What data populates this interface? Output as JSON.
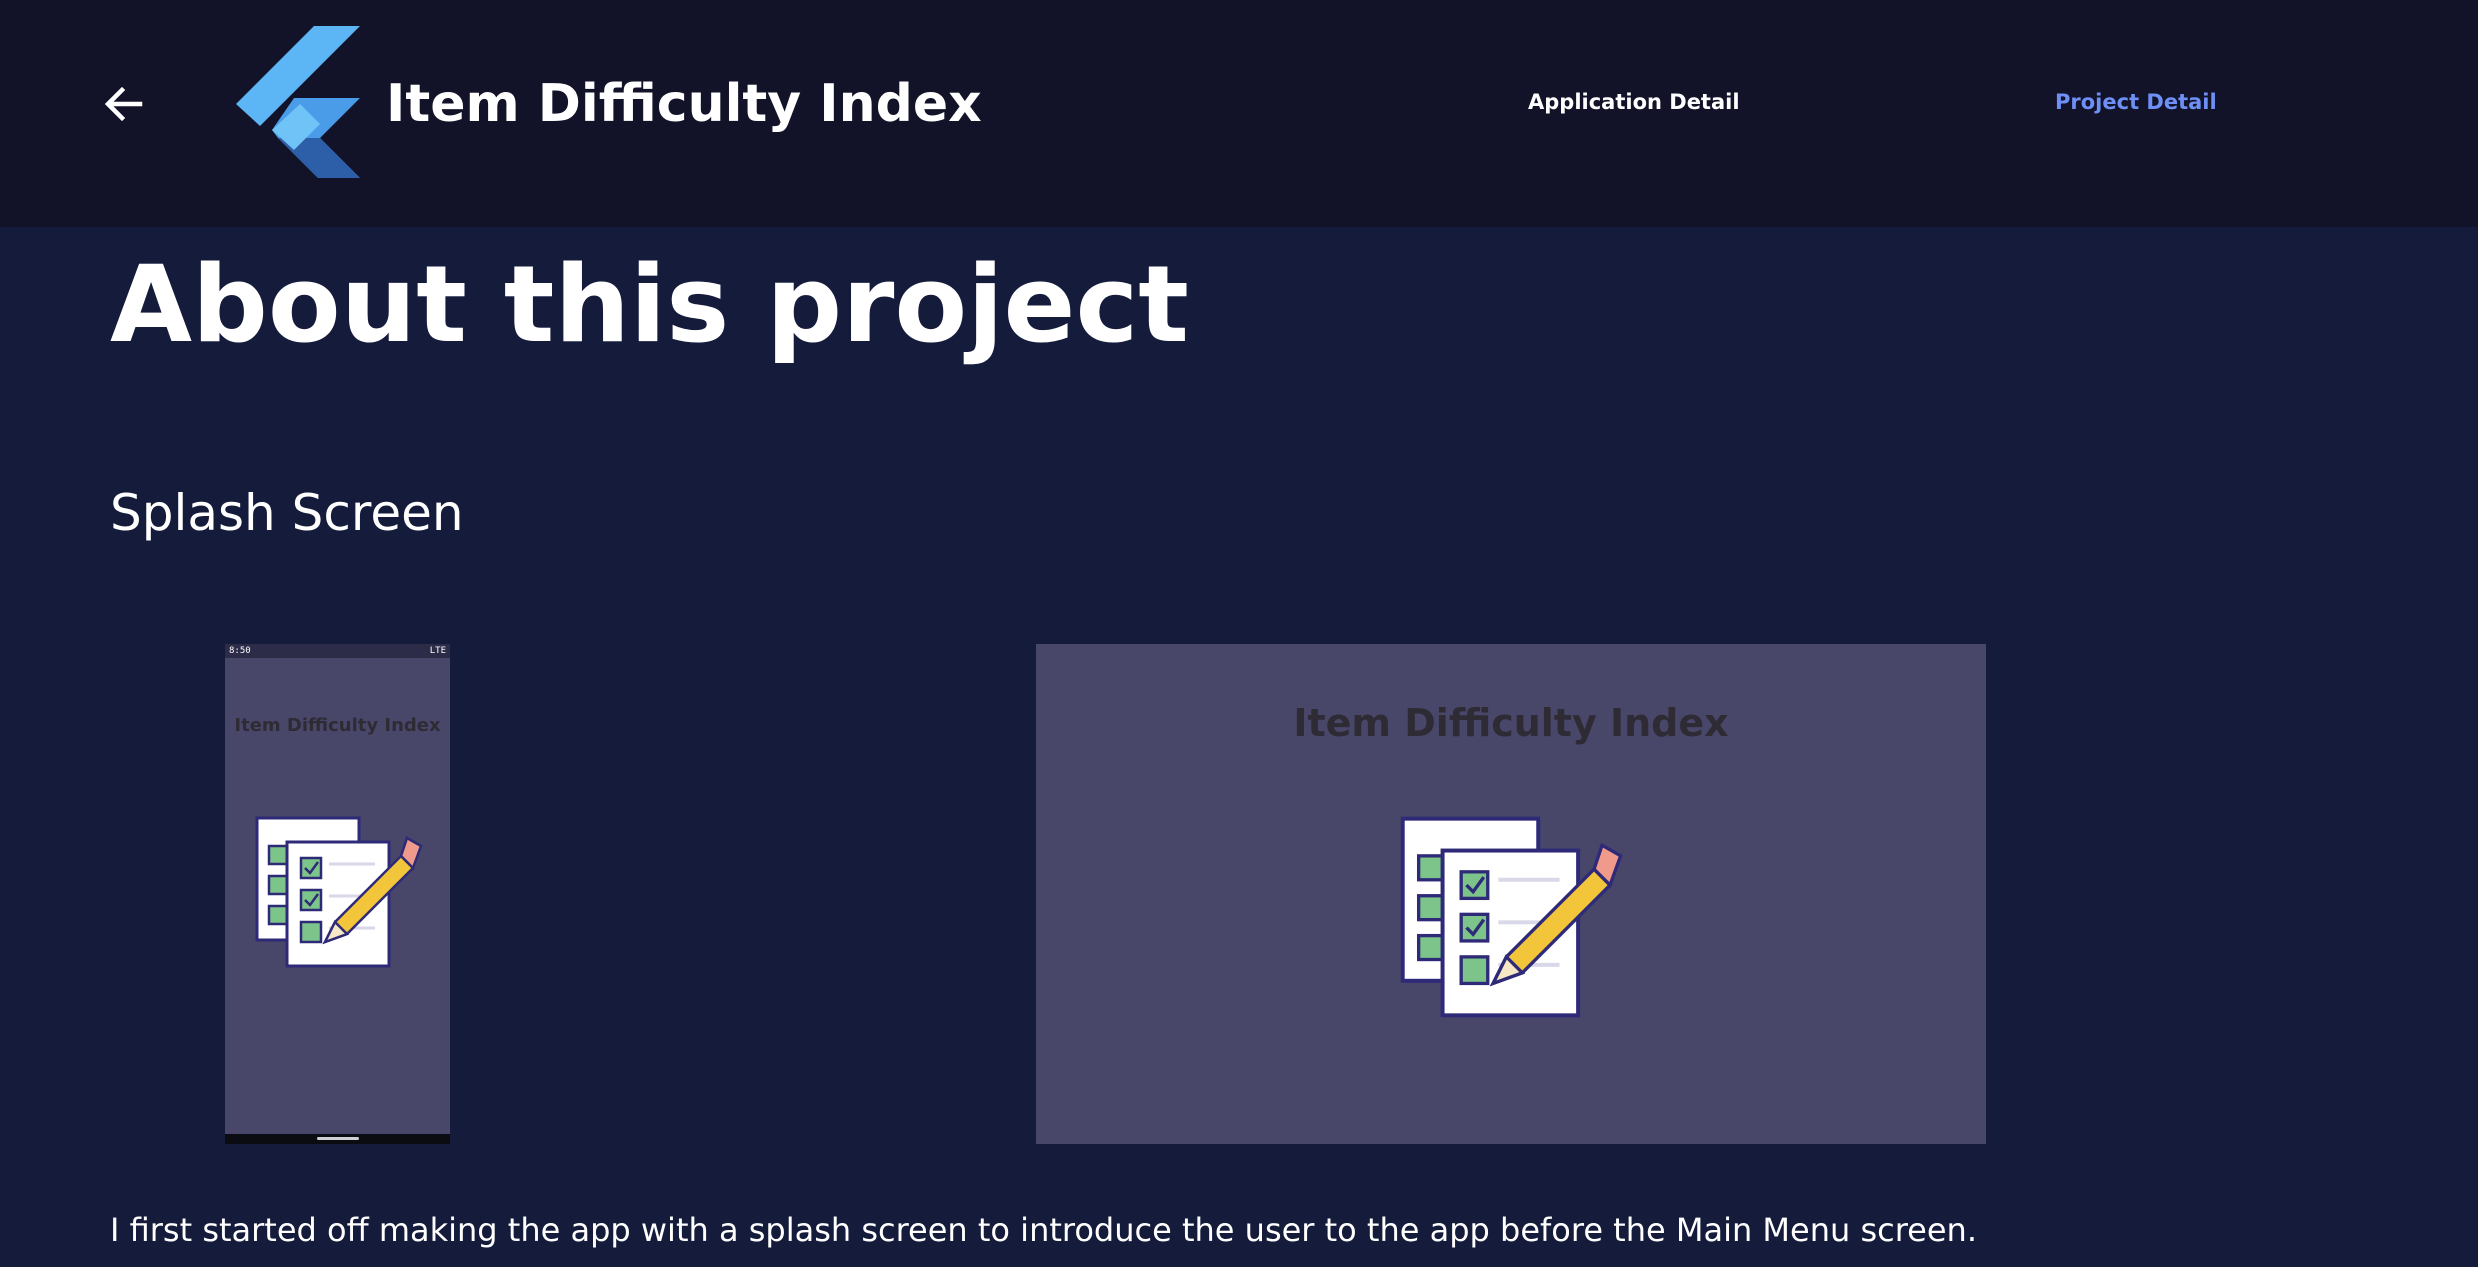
{
  "header": {
    "back_icon": "arrow-left-icon",
    "logo_icon": "flutter-logo-icon",
    "app_title": "Item Difficulty Index",
    "nav": [
      {
        "label": "Application Detail",
        "active": false
      },
      {
        "label": "Project Detail",
        "active": true
      }
    ],
    "active_color": "#6e8ff5"
  },
  "main": {
    "page_title": "About this project",
    "section_title": "Splash Screen",
    "phone_screenshot": {
      "status_time": "8:50",
      "status_network": "LTE",
      "title": "Item Difficulty Index",
      "illustration_icon": "checklist-pencil-icon"
    },
    "tablet_screenshot": {
      "title": "Item Difficulty Index",
      "illustration_icon": "checklist-pencil-icon"
    },
    "description": "I first started off making the app with a splash screen to introduce the user to the app before the Main Menu screen."
  },
  "colors": {
    "header_bg": "#121228",
    "page_bg": "#151b3b",
    "screenshot_bg": "#484769"
  }
}
